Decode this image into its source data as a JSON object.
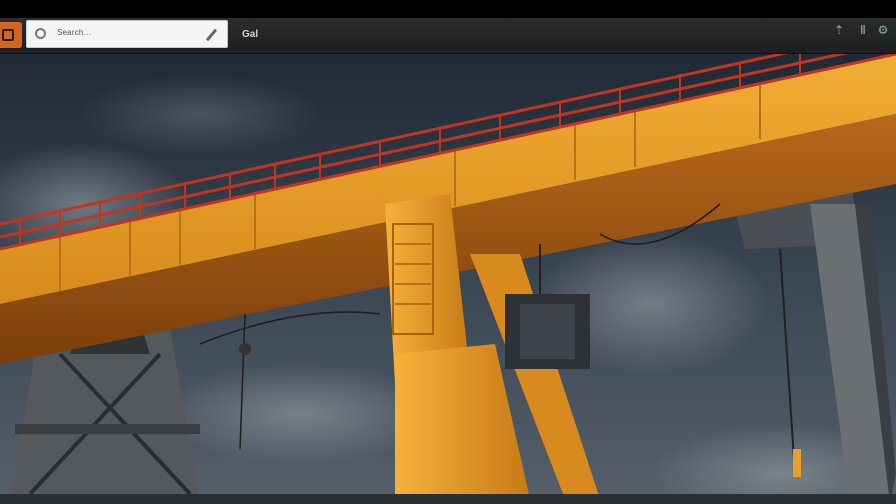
{
  "toolbar": {
    "search_text": "Search…",
    "label": "Gal",
    "icons": [
      "logo-icon",
      "search-icon",
      "pen-icon",
      "share-icon",
      "menu-icon"
    ]
  },
  "scene": {
    "subject": "orange gantry crane",
    "colors": {
      "crane": "#e8a126",
      "crane_shadow": "#a85d10",
      "railing": "#c2341f",
      "sky": "#2f3a45",
      "steel": "#3b3f44"
    }
  }
}
